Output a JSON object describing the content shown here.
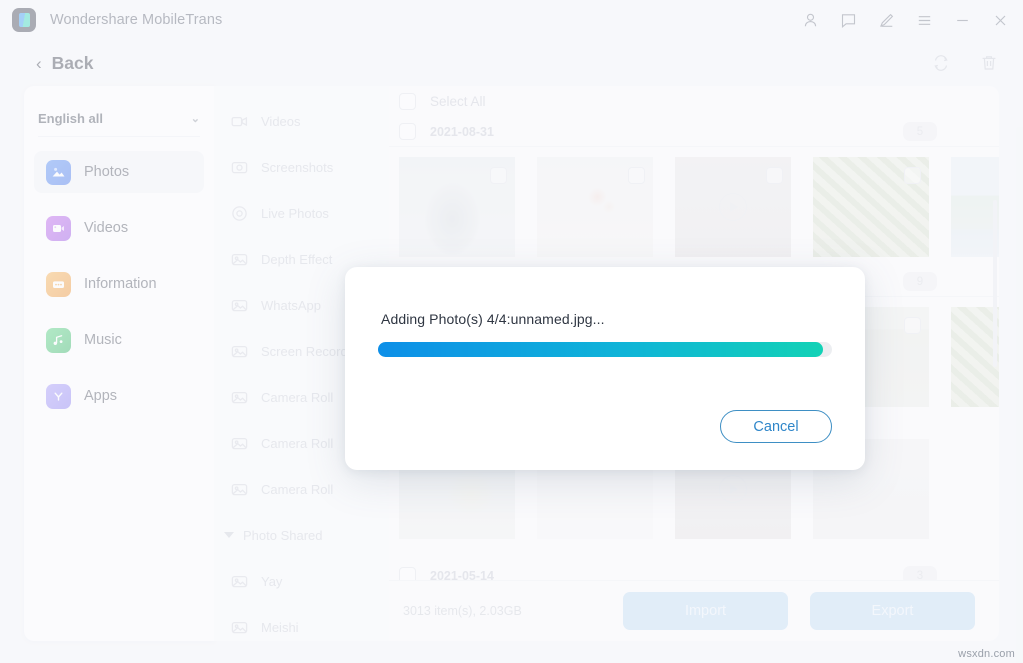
{
  "window": {
    "app_title": "Wondershare MobileTrans",
    "logo_name": "mobiletrans-logo",
    "title_icons": [
      {
        "name": "account-icon",
        "glyph": "person"
      },
      {
        "name": "feedback-icon",
        "glyph": "chat"
      },
      {
        "name": "edit-icon",
        "glyph": "pencil"
      },
      {
        "name": "menu-icon",
        "glyph": "hamburger"
      },
      {
        "name": "minimize-icon",
        "glyph": "minus"
      },
      {
        "name": "close-icon",
        "glyph": "cross"
      }
    ]
  },
  "toolbar": {
    "back_label": "Back",
    "back_chevron": "‹",
    "actions": [
      {
        "name": "refresh-icon",
        "glyph": "refresh"
      },
      {
        "name": "delete-icon",
        "glyph": "trash"
      }
    ]
  },
  "sidebar": {
    "language_label": "English all",
    "language_caret": "⌄",
    "items": [
      {
        "label": "Photos",
        "icon": "photos-icon",
        "active": true
      },
      {
        "label": "Videos",
        "icon": "videos-icon",
        "active": false
      },
      {
        "label": "Information",
        "icon": "information-icon",
        "active": false
      },
      {
        "label": "Music",
        "icon": "music-icon",
        "active": false
      },
      {
        "label": "Apps",
        "icon": "apps-icon",
        "active": false
      }
    ]
  },
  "albums": {
    "items": [
      {
        "label": "Videos",
        "icon": "video-album-icon",
        "type": "album"
      },
      {
        "label": "Screenshots",
        "icon": "screenshot-album-icon",
        "type": "album"
      },
      {
        "label": "Live Photos",
        "icon": "live-photo-album-icon",
        "type": "album"
      },
      {
        "label": "Depth Effect",
        "icon": "photo-album-icon",
        "type": "album"
      },
      {
        "label": "WhatsApp",
        "icon": "photo-album-icon",
        "type": "album"
      },
      {
        "label": "Screen Recorder",
        "icon": "photo-album-icon",
        "type": "album"
      },
      {
        "label": "Camera Roll",
        "icon": "photo-album-icon",
        "type": "album"
      },
      {
        "label": "Camera Roll",
        "icon": "photo-album-icon",
        "type": "album"
      },
      {
        "label": "Camera Roll",
        "icon": "photo-album-icon",
        "type": "album"
      },
      {
        "label": "Photo Shared",
        "icon": "expand-triangle-icon",
        "type": "group"
      },
      {
        "label": "Yay",
        "icon": "photo-album-icon",
        "type": "album"
      },
      {
        "label": "Meishi",
        "icon": "photo-album-icon",
        "type": "album"
      }
    ]
  },
  "content": {
    "select_all_label": "Select All",
    "groups": [
      {
        "date": "2021-08-31",
        "count": "5",
        "thumbs": [
          {
            "name": "photo-person",
            "style": "p-person",
            "video": false
          },
          {
            "name": "photo-flowers",
            "style": "p-flowers",
            "video": false
          },
          {
            "name": "video-clip",
            "style": "p-video",
            "video": true
          },
          {
            "name": "photo-leaves",
            "style": "p-leaves",
            "video": false
          },
          {
            "name": "photo-beach",
            "style": "p-beach",
            "video": false
          }
        ]
      },
      {
        "date": "",
        "count": "9",
        "thumbs": [
          {
            "name": "photo-hidden-1",
            "style": "p-plain",
            "video": false
          },
          {
            "name": "photo-hidden-2",
            "style": "p-plain",
            "video": false
          },
          {
            "name": "photo-hidden-3",
            "style": "p-plain",
            "video": false
          },
          {
            "name": "photo-house",
            "style": "p-house",
            "video": false
          },
          {
            "name": "photo-leaves-2",
            "style": "p-leaves",
            "video": false
          }
        ]
      },
      {
        "date": "",
        "count": "",
        "thumbs": [
          {
            "name": "photo-illustration",
            "style": "p-illus",
            "video": false
          },
          {
            "name": "photo-diagram",
            "style": "p-diagram",
            "video": false
          },
          {
            "name": "video-clip-2",
            "style": "p-video",
            "video": true
          },
          {
            "name": "photo-cable",
            "style": "p-cable",
            "video": false
          }
        ]
      }
    ],
    "last_date": "2021-05-14",
    "last_count": "3"
  },
  "footer": {
    "count_info": "3013 item(s), 2.03GB",
    "import_label": "Import",
    "export_label": "Export"
  },
  "modal": {
    "message": "Adding Photo(s) 4/4:unnamed.jpg...",
    "progress_percent": 98,
    "cancel_label": "Cancel"
  },
  "watermark": "wsxdn.com",
  "colors": {
    "progress_start": "#0d8fe8",
    "progress_end": "#12d2b6",
    "cancel_border": "#3e8fc4",
    "cancel_text": "#2f86c9",
    "button_disabled": "#bcd9f2"
  }
}
